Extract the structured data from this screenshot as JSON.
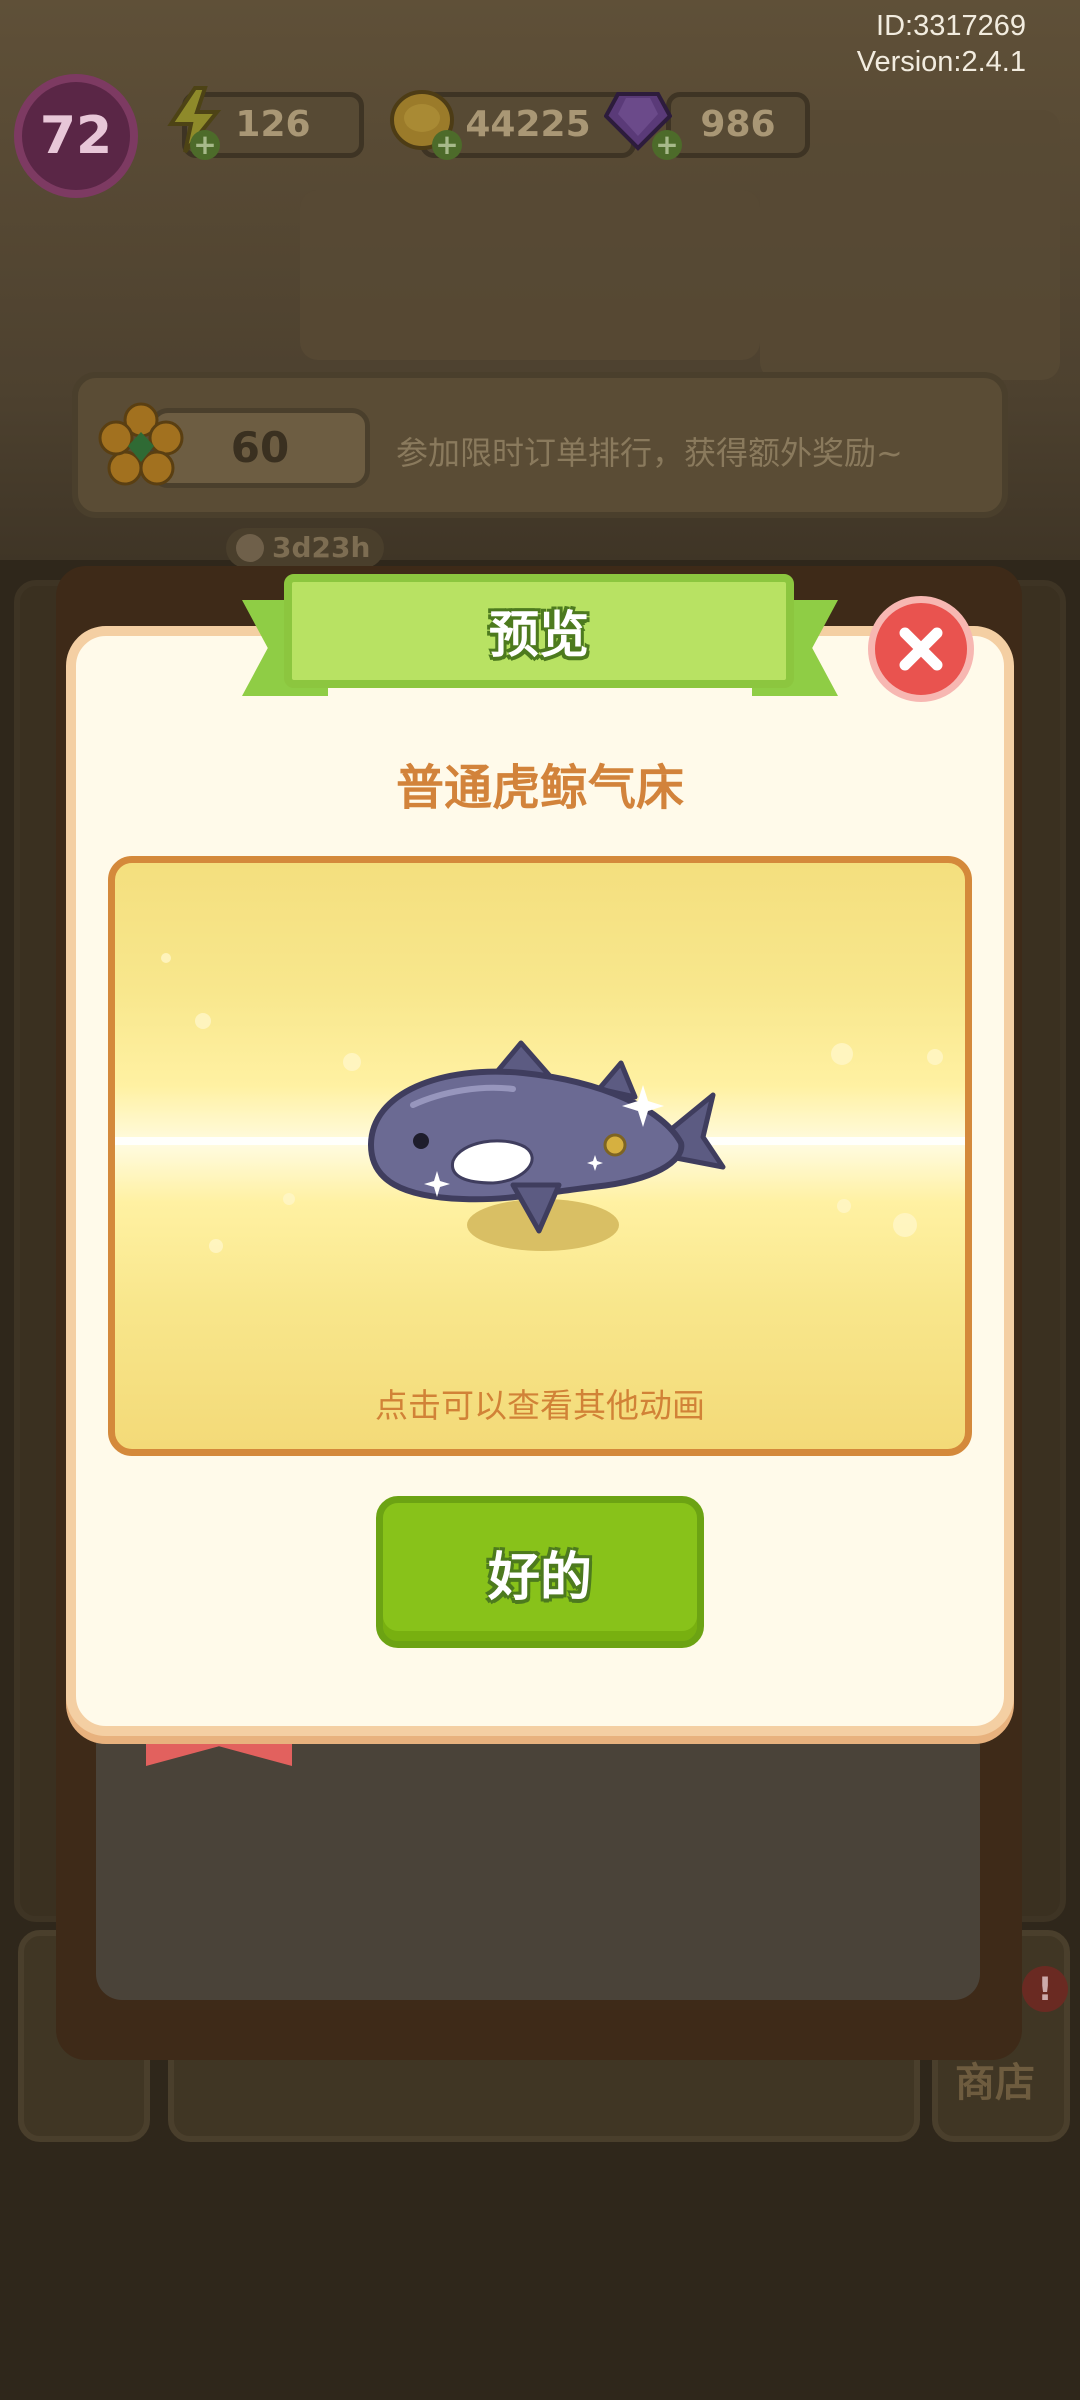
{
  "meta": {
    "id": "ID:3317269",
    "version": "Version:2.4.1"
  },
  "resources": {
    "level": "72",
    "energy": "126",
    "coins": "44225",
    "gems": "986"
  },
  "event": {
    "score": "60",
    "text": "参加限时订单排行，获得额外奖励~"
  },
  "background": {
    "timer": "3d23h",
    "shop_label": "商店"
  },
  "dialog": {
    "title": "预览",
    "item_name": "普通虎鲸气床",
    "hint": "点击可以查看其他动画",
    "ok_label": "好的"
  },
  "colors": {
    "title_green": "#b8e263",
    "ok_green": "#88c21a",
    "close_red": "#e9534f",
    "item_orange": "#d2833b"
  },
  "icons": [
    "energy-icon",
    "coin-icon",
    "gem-icon",
    "flower-icon",
    "close-icon",
    "clock-icon",
    "orca-bed-icon"
  ]
}
